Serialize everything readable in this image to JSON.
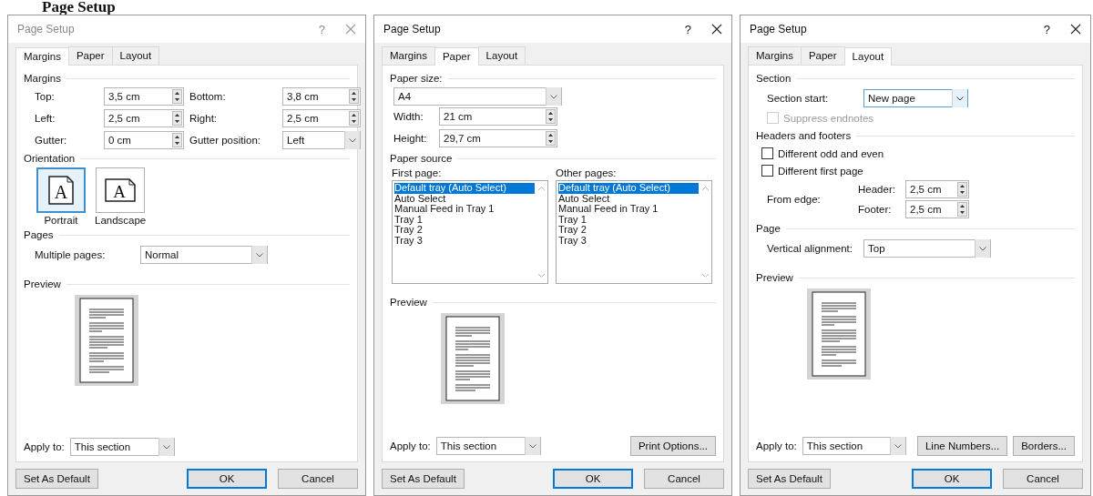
{
  "heading": "Page Setup",
  "dialogs": [
    {
      "title": "Page Setup",
      "active": false,
      "help": "?",
      "tabs": [
        {
          "label": "Margins",
          "selected": true
        },
        {
          "label": "Paper",
          "selected": false
        },
        {
          "label": "Layout",
          "selected": false
        }
      ],
      "panel": {
        "kind": "margins",
        "margins_title": "Margins",
        "fields": [
          {
            "label": "Top:",
            "value": "3,5 cm",
            "kind": "spin"
          },
          {
            "label": "Bottom:",
            "value": "3,8 cm",
            "kind": "spin"
          },
          {
            "label": "Left:",
            "value": "2,5 cm",
            "kind": "spin"
          },
          {
            "label": "Right:",
            "value": "2,5 cm",
            "kind": "spin"
          },
          {
            "label": "Gutter:",
            "value": "0 cm",
            "kind": "spin"
          },
          {
            "label": "Gutter position:",
            "value": "Left",
            "kind": "select"
          }
        ],
        "orientation_title": "Orientation",
        "orientations": [
          {
            "label": "Portrait",
            "glyph": "A",
            "selected": true
          },
          {
            "label": "Landscape",
            "glyph": "A",
            "selected": false
          }
        ],
        "pages_title": "Pages",
        "multiple_pages": {
          "label": "Multiple pages:",
          "value": "Normal"
        }
      },
      "preview_title": "Preview",
      "apply_to": {
        "label": "Apply to:",
        "value": "This section"
      },
      "set_default": "Set As Default",
      "buttons": [
        {
          "label": "OK",
          "default": true
        },
        {
          "label": "Cancel",
          "default": false
        }
      ]
    },
    {
      "title": "Page Setup",
      "active": true,
      "help": "?",
      "tabs": [
        {
          "label": "Margins",
          "selected": false
        },
        {
          "label": "Paper",
          "selected": true
        },
        {
          "label": "Layout",
          "selected": false
        }
      ],
      "panel": {
        "kind": "paper",
        "size_title": "Paper size:",
        "size": "A4",
        "dims": [
          {
            "label": "Width:",
            "value": "21 cm"
          },
          {
            "label": "Height:",
            "value": "29,7 cm"
          }
        ],
        "source_title": "Paper source",
        "lists": [
          {
            "label": "First page:",
            "items": [
              {
                "text": "Default tray (Auto Select)",
                "selected": true
              },
              {
                "text": "Auto Select",
                "selected": false
              },
              {
                "text": "Manual Feed in Tray 1",
                "selected": false
              },
              {
                "text": "Tray 1",
                "selected": false
              },
              {
                "text": "Tray 2",
                "selected": false
              },
              {
                "text": "Tray 3",
                "selected": false
              }
            ]
          },
          {
            "label": "Other pages:",
            "items": [
              {
                "text": "Default tray (Auto Select)",
                "selected": true
              },
              {
                "text": "Auto Select",
                "selected": false
              },
              {
                "text": "Manual Feed in Tray 1",
                "selected": false
              },
              {
                "text": "Tray 1",
                "selected": false
              },
              {
                "text": "Tray 2",
                "selected": false
              },
              {
                "text": "Tray 3",
                "selected": false
              }
            ]
          }
        ]
      },
      "preview_title": "Preview",
      "apply_to": {
        "label": "Apply to:",
        "value": "This section"
      },
      "side_buttons": [
        "Print Options..."
      ],
      "set_default": "Set As Default",
      "buttons": [
        {
          "label": "OK",
          "default": true
        },
        {
          "label": "Cancel",
          "default": false
        }
      ]
    },
    {
      "title": "Page Setup",
      "active": true,
      "help": "?",
      "tabs": [
        {
          "label": "Margins",
          "selected": false
        },
        {
          "label": "Paper",
          "selected": false
        },
        {
          "label": "Layout",
          "selected": true
        }
      ],
      "panel": {
        "kind": "layout",
        "section_title": "Section",
        "section_start": {
          "label": "Section start:",
          "value": "New page"
        },
        "section_checks": [
          {
            "label": "Suppress endnotes",
            "checked": false,
            "disabled": true
          }
        ],
        "hf_title": "Headers and footers",
        "hf_checks": [
          {
            "label": "Different odd and even",
            "checked": false,
            "disabled": false
          },
          {
            "label": "Different first page",
            "checked": false,
            "disabled": false
          }
        ],
        "from_edge": "From edge:",
        "edges": [
          {
            "label": "Header:",
            "value": "2,5 cm"
          },
          {
            "label": "Footer:",
            "value": "2,5 cm"
          }
        ],
        "page_title": "Page",
        "valign": {
          "label": "Vertical alignment:",
          "value": "Top"
        }
      },
      "preview_title": "Preview",
      "apply_to": {
        "label": "Apply to:",
        "value": "This section"
      },
      "side_buttons": [
        "Line Numbers...",
        "Borders..."
      ],
      "set_default": "Set As Default",
      "buttons": [
        {
          "label": "OK",
          "default": true
        },
        {
          "label": "Cancel",
          "default": false
        }
      ]
    }
  ]
}
